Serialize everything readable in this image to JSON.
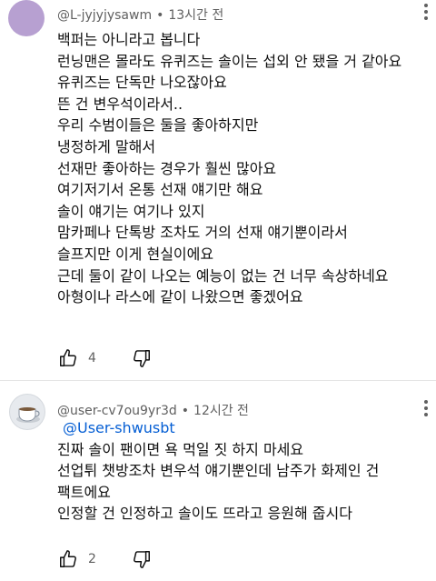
{
  "comments": [
    {
      "author": "@L-jyjyjysawm",
      "time": "13시간 전",
      "lines": [
        "백퍼는 아니라고 봅니다",
        "런닝맨은 몰라도 유퀴즈는 솔이는 섭외 안 됐을 거 같아요",
        "유퀴즈는 단독만 나오잖아요",
        "뜬 건 변우석이라서..",
        "우리 수범이들은 둘을 좋아하지만",
        "냉정하게 말해서",
        "선재만 좋아하는 경우가 훨씬 많아요",
        "여기저기서 온통 선재 얘기만 해요",
        "솔이 얘기는 여기나 있지",
        "맘카페나 단톡방 조차도 거의 선재 얘기뿐이라서",
        "슬프지만 이게 현실이에요",
        "근데 둘이 같이 나오는 예능이 없는 건 너무 속상하네요",
        "아형이나 라스에 같이 나왔으면 좋겠어요"
      ],
      "likes": "4"
    },
    {
      "author": "@user-cv7ou9yr3d",
      "time": "12시간 전",
      "mention": "@User-shwusbt",
      "lines": [
        "진짜 솔이 팬이면 욕 먹일 짓 하지 마세요",
        "선업튀 챗방조차 변우석 얘기뿐인데 남주가 화제인 건",
        "팩트에요",
        "인정할 건 인정하고 솔이도 뜨라고 응원해 줍시다"
      ],
      "likes": "2"
    }
  ],
  "icons": {
    "like": "thumbs-up-outline-icon",
    "dislike": "thumbs-down-outline-icon",
    "more": "more-vertical-icon"
  },
  "colors": {
    "text": "#0f0f0f",
    "meta": "#606060",
    "mention": "#065fd4",
    "avatar1": "#b7a0d1"
  }
}
